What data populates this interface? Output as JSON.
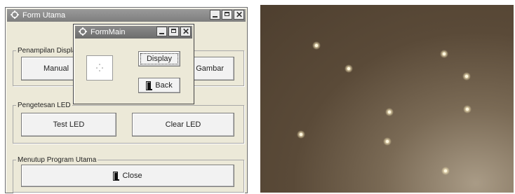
{
  "main_window": {
    "title": "Form Utama",
    "groups": {
      "display": {
        "legend": "Penampilan Display",
        "buttons": {
          "manual": "Manual",
          "gambar": "Gambar"
        }
      },
      "led": {
        "legend": "Pengetesan LED",
        "buttons": {
          "test": "Test LED",
          "clear": "Clear LED"
        }
      },
      "close": {
        "legend": "Menutup Program Utama",
        "buttons": {
          "close": "Close"
        }
      }
    }
  },
  "dialog": {
    "title": "FormMain",
    "buttons": {
      "display": "Display",
      "back": "Back"
    }
  },
  "photo": {
    "led_count": 10,
    "colors": {
      "background": "#5a4a38",
      "led": "#fff7e0"
    }
  }
}
